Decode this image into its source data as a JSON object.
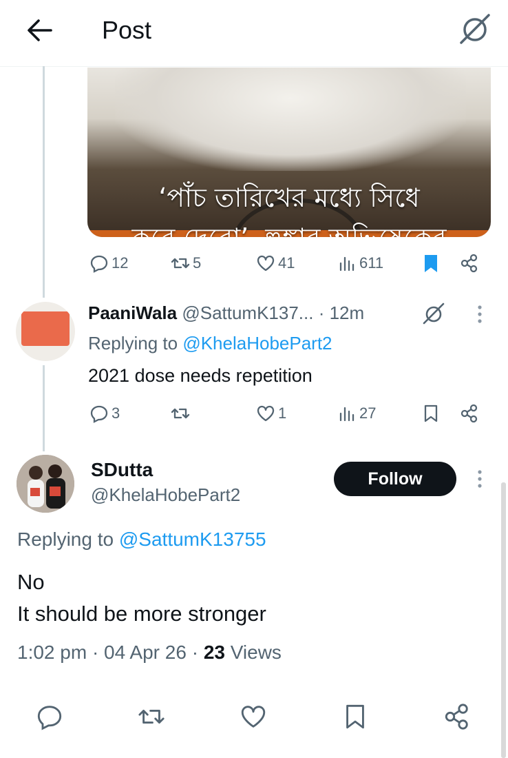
{
  "header": {
    "title": "Post"
  },
  "media": {
    "headline_line1": "‘পাঁচ তারিখের মধ্যে সিধে",
    "headline_line2": "করে দেবো’, হুঙ্কার অভিষেকের"
  },
  "tweet_top_stats": {
    "replies": "12",
    "retweets": "5",
    "likes": "41",
    "views": "611"
  },
  "reply1": {
    "display_name": "PaaniWala",
    "handle": "@SattumK137...",
    "time": "· 12m",
    "replying_prefix": "Replying to ",
    "replying_to": "@KhelaHobePart2",
    "text": "2021 dose needs repetition",
    "stats": {
      "replies": "3",
      "retweets": "",
      "likes": "1",
      "views": "27"
    }
  },
  "main": {
    "display_name": "SDutta",
    "handle": "@KhelaHobePart2",
    "follow_label": "Follow",
    "replying_prefix": "Replying to ",
    "replying_to": "@SattumK13755",
    "text_line1": "No",
    "text_line2": "It should be more stronger",
    "meta_time": "1:02 pm · 04 Apr 26 · ",
    "views_count": "23",
    "views_label": " Views"
  },
  "colors": {
    "link": "#1d9bf0",
    "muted": "#536471",
    "bookmark_active": "#1d9bf0",
    "follow_bg": "#0f1419"
  }
}
